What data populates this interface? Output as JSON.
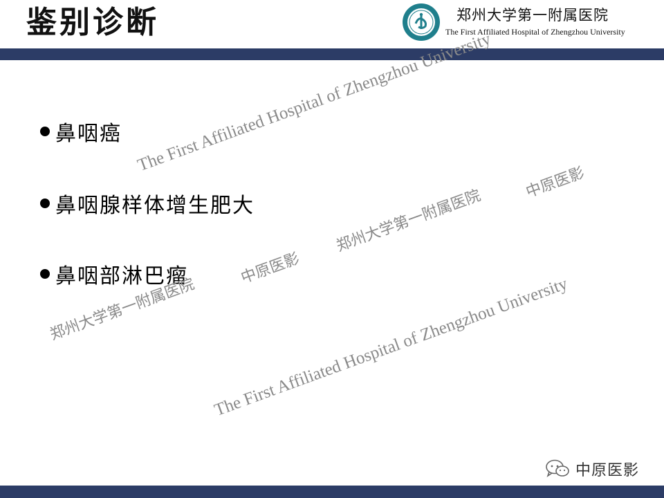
{
  "slide": {
    "title": "鉴别诊断",
    "hospital_name_cn": "郑州大学第一附属医院",
    "hospital_name_en": "The First Affiliated Hospital of Zhengzhou University",
    "logo_icon": "hospital-seal-icon"
  },
  "bullets": [
    "鼻咽癌",
    "鼻咽腺样体增生肥大",
    "鼻咽部淋巴瘤"
  ],
  "watermarks": {
    "english": "The First Affiliated Hospital of Zhengzhou University",
    "hospital_cn": "郑州大学第一附属医院",
    "brand_cn": "中原医影"
  },
  "footer": {
    "brand": "中原医影",
    "brand_icon": "wechat-icon"
  },
  "colors": {
    "bar": "#2c3c66",
    "logo_teal": "#1f7f8c",
    "watermark": "#8a8a8a"
  }
}
